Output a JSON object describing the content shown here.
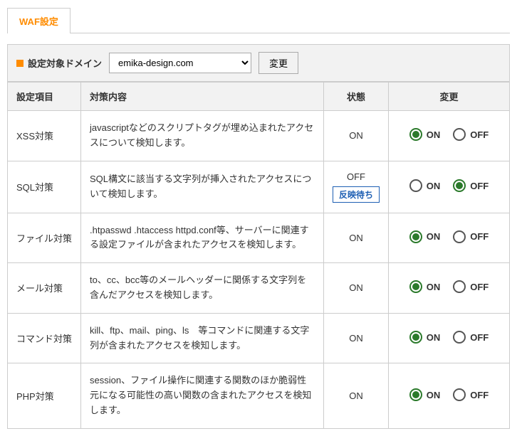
{
  "tab": {
    "label": "WAF設定"
  },
  "domainRow": {
    "label": "設定対象ドメイン",
    "selected": "emika-design.com",
    "button": "変更"
  },
  "headers": {
    "item": "設定項目",
    "content": "対策内容",
    "state": "状態",
    "change": "変更"
  },
  "radioLabels": {
    "on": "ON",
    "off": "OFF"
  },
  "pendingLabel": "反映待ち",
  "rows": [
    {
      "name": "XSS対策",
      "desc": "javascriptなどのスクリプトタグが埋め込まれたアクセスについて検知します。",
      "state": "ON",
      "pending": false,
      "selected": "on"
    },
    {
      "name": "SQL対策",
      "desc": "SQL構文に該当する文字列が挿入されたアクセスについて検知します。",
      "state": "OFF",
      "pending": true,
      "selected": "off"
    },
    {
      "name": "ファイル対策",
      "desc": ".htpasswd .htaccess httpd.conf等、サーバーに関連する設定ファイルが含まれたアクセスを検知します。",
      "state": "ON",
      "pending": false,
      "selected": "on"
    },
    {
      "name": "メール対策",
      "desc": "to、cc、bcc等のメールヘッダーに関係する文字列を含んだアクセスを検知します。",
      "state": "ON",
      "pending": false,
      "selected": "on"
    },
    {
      "name": "コマンド対策",
      "desc": "kill、ftp、mail、ping、ls　等コマンドに関連する文字列が含まれたアクセスを検知します。",
      "state": "ON",
      "pending": false,
      "selected": "on"
    },
    {
      "name": "PHP対策",
      "desc": "session、ファイル操作に関連する関数のほか脆弱性元になる可能性の高い関数の含まれたアクセスを検知します。",
      "state": "ON",
      "pending": false,
      "selected": "on"
    }
  ]
}
